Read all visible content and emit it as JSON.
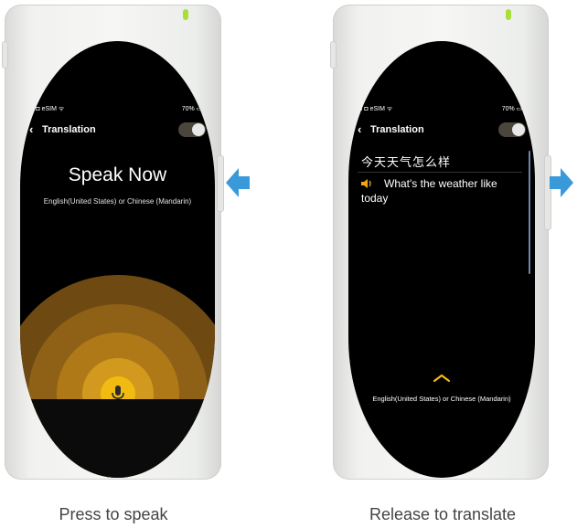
{
  "left_panel": {
    "status": {
      "carrier": "ııl ◘ eSIM ᯤ",
      "battery": "70% ▭ϟ"
    },
    "header": {
      "title": "Translation"
    },
    "speak_now": "Speak Now",
    "language_hint": "English(United States) or Chinese (Mandarin)",
    "caption": "Press to speak"
  },
  "right_panel": {
    "status": {
      "carrier": "ııl ◘ eSIM ᯤ",
      "battery": "70% ▭ϟ"
    },
    "header": {
      "title": "Translation"
    },
    "source_text": "今天天气怎么样",
    "translated_text": "What's the weather like today",
    "language_bar": "English(United States) or Chinese (Mandarin)",
    "caption": "Release to translate"
  },
  "colors": {
    "accent_yellow": "#f2bb12",
    "arrow_blue": "#3a9ad9",
    "led_green": "#a8e038",
    "screen_black": "#000000"
  },
  "icons": [
    "back-chevron-icon",
    "toggle-switch",
    "microphone-icon",
    "speaker-icon",
    "chevron-up-icon",
    "arrow-left-icon",
    "arrow-right-icon"
  ]
}
